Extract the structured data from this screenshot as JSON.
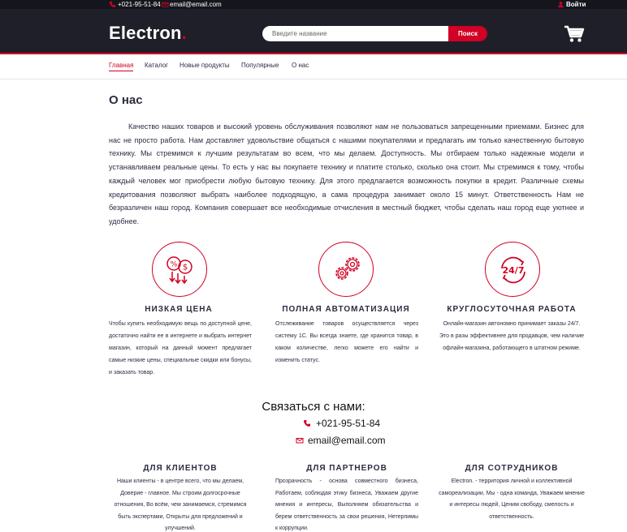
{
  "topbar": {
    "phone": "+021-95-51-84",
    "email": "email@email.com",
    "login": "Войти"
  },
  "header": {
    "logo": "Electron",
    "logo_dot": ".",
    "search_placeholder": "Введите название",
    "search_button": "Поиск"
  },
  "nav": {
    "items": [
      "Главная",
      "Каталог",
      "Новые продукты",
      "Популярные",
      "О нас"
    ]
  },
  "page_title": "О нас",
  "about_text": "Качество наших товаров и высокий уровень обслуживания позволяют нам не пользоваться запрещенными приемами. Бизнес для нас не просто работа. Нам доставляет удовольствие общаться с нашими покупателями и предлагать им только качественную бытовую технику. Мы стремимся к лучшим результатам во всем, что мы делаем. Доступность. Мы отбираем только надежные модели и устанавливаем реальные цены. То есть у нас вы покупаете технику и платите столько, сколько она стоит. Мы стремимся к тому, чтобы каждый человек мог приобрести любую бытовую технику. Для этого предлагается возможность покупки в кредит. Различные схемы кредитования позволяют выбрать наиболее подходящую, а сама процедура занимает около 15 минут. Ответственность Нам не безразличен наш город. Компания совершает все необходимые отчисления в местный бюджет, чтобы сделать наш город еще уютнее и удобнее.",
  "features": [
    {
      "icon": "discount-icon",
      "title": "НИЗКАЯ ЦЕНА",
      "text": "Чтобы купить необходимую вещь по доступной цене, достаточно найти ее в интернете и выбрать интернет магазин, который на данный момент предлагает самые низкие цены, специальные скидки или бонусы, и заказать товар."
    },
    {
      "icon": "gears-icon",
      "title": "ПОЛНАЯ АВТОМАТИЗАЦИЯ",
      "text": "Отслеживание товаров осуществляется через систему 1С. Вы всегда знаете, где хранится товар, в каком количестве, легко можете его найти и изменить статус."
    },
    {
      "icon": "24-7-icon",
      "title": "КРУГЛОСУТОЧНАЯ РАБОТА",
      "text": "Онлайн-магазин автономно принимает заказы 24/7. Это в разы эффективнее для продавцов, чем наличие офлайн-магазина, работающего в штатном режиме."
    }
  ],
  "contact": {
    "title": "Связаться с нами:",
    "phone": "+021-95-51-84",
    "email": "email@email.com"
  },
  "columns": [
    {
      "title": "ДЛЯ КЛИЕНТОВ",
      "text": "Наши клиенты - в центре всего, что мы делаем, Доверие - главное. Мы строим долгосрочные отношения, Во всём, чем занимаемся, стремимся быть экспертами, Открыты для предложений и улучшений."
    },
    {
      "title": "ДЛЯ ПАРТНЕРОВ",
      "text": "Прозрачность - основа совместного бизнеса, Работаем, соблюдая этику бизнеса, Уважаем другие мнения и интересы, Выполняем обязательства и берем ответственность за свои решения, Нетерпимы к коррупции."
    },
    {
      "title": "ДЛЯ СОТРУДНИКОВ",
      "text": "Electron. - территория личной и коллективной самореализации, Мы - одна команда, Уважаем мнение и интересы людей, Ценим свободу, смелость и ответственность."
    }
  ],
  "colors": {
    "accent": "#d10024",
    "header_bg": "#1e1f29",
    "topbar_bg": "#15161d",
    "text": "#2b2d42"
  }
}
